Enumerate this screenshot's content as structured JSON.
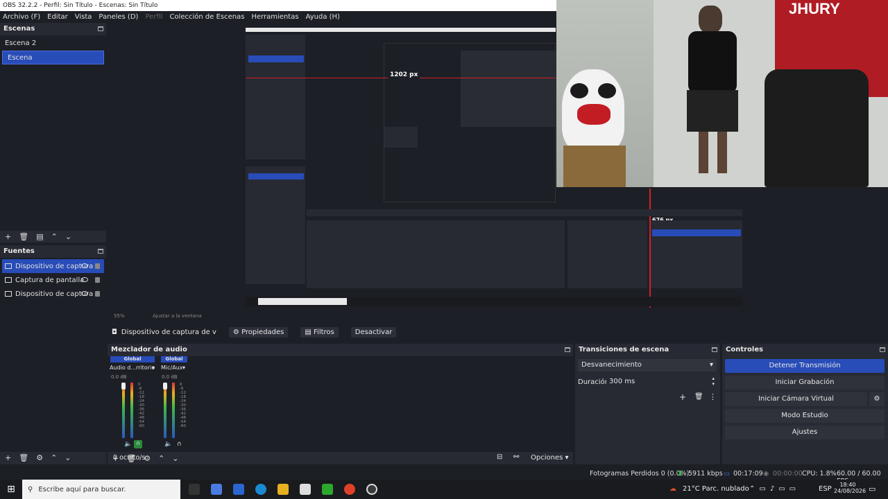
{
  "window": {
    "title": "OBS 32.2.2 - Perfil: Sin Título - Escenas: Sin Título"
  },
  "menu": [
    "Archivo (F)",
    "Editar",
    "Vista",
    "Paneles (D)",
    "Perfil",
    "Colección de Escenas",
    "Herramientas",
    "Ayuda (H)"
  ],
  "scenes": {
    "title": "Escenas",
    "items": [
      "Escena 2",
      "Escena"
    ],
    "selected": 1
  },
  "sources": {
    "title": "Fuentes",
    "items": [
      {
        "label": "Dispositivo de captura",
        "icon": "camera-icon",
        "selected": true
      },
      {
        "label": "Captura de pantalla",
        "icon": "monitor-icon",
        "selected": false
      },
      {
        "label": "Dispositivo de captura",
        "icon": "camera-icon",
        "selected": false
      }
    ]
  },
  "preview": {
    "measure_h": "1202 px",
    "measure_v": "676 px",
    "zoom": "55%",
    "fit": "Ajustar a la ventana"
  },
  "context": {
    "source": "Dispositivo de captura de v",
    "properties": "Propiedades",
    "filters": "Filtros",
    "deactivate": "Desactivar"
  },
  "mixer": {
    "title": "Mezclador de audio",
    "channels": [
      {
        "badge": "Global",
        "name": "Audio d...rritorio",
        "db": "0.0 dB"
      },
      {
        "badge": "Global",
        "name": "Mic/Aux",
        "db": "0.0 dB"
      }
    ],
    "scale": [
      "0",
      "-6",
      "-12",
      "-18",
      "-24",
      "-30",
      "-36",
      "-42",
      "-48",
      "-54",
      "-60"
    ],
    "hidden": "0 oculto/s",
    "options": "Opciones"
  },
  "transitions": {
    "title": "Transiciones de escena",
    "selected": "Desvanecimiento",
    "duration_label": "Duración",
    "duration_value": "300 ms"
  },
  "controls": {
    "title": "Controles",
    "stop_stream": "Detener Transmisión",
    "start_record": "Iniciar Grabación",
    "start_vcam": "Iniciar Cámara Virtual",
    "studio_mode": "Modo Estudio",
    "settings": "Ajustes"
  },
  "status": {
    "dropped": "Fotogramas Perdidos 0 (0.0%)",
    "bitrate": "5911 kbps",
    "stream_time": "00:17:09",
    "rec_time": "00:00:00",
    "cpu": "CPU: 1.8%",
    "fps": "60.00 / 60.00 FPS"
  },
  "taskbar": {
    "search_placeholder": "Escribe aquí para buscar.",
    "weather": "21°C  Parc. nublado",
    "lang": "ESP",
    "time": "18:40",
    "date": "24/08/2026"
  },
  "camera_overlay": {
    "poster_text": "JHURY"
  },
  "colors": {
    "accent": "#284cb8",
    "bg": "#1d1f26",
    "panel": "#272a33",
    "record_line": "#d21f26"
  }
}
